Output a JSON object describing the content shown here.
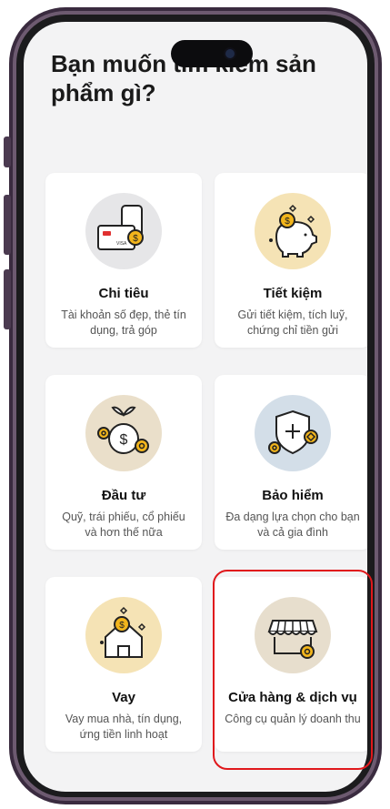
{
  "page": {
    "title": "Bạn muốn tìm kiếm sản phẩm gì?"
  },
  "cards": [
    {
      "title": "Chi tiêu",
      "desc": "Tài khoản số đẹp, thẻ tín dụng, trả góp",
      "icon": "card-payment-icon"
    },
    {
      "title": "Tiết kiệm",
      "desc": "Gửi tiết kiệm, tích luỹ, chứng chỉ tiền gửi",
      "icon": "piggy-bank-icon"
    },
    {
      "title": "Đầu tư",
      "desc": "Quỹ, trái phiếu, cổ phiếu và hơn thế nữa",
      "icon": "money-bag-icon"
    },
    {
      "title": "Bảo hiểm",
      "desc": "Đa dạng lựa chọn cho bạn và cả gia đình",
      "icon": "shield-plus-icon"
    },
    {
      "title": "Vay",
      "desc": "Vay mua nhà, tín dụng, ứng tiền linh hoạt",
      "icon": "house-coin-icon"
    },
    {
      "title": "Cửa hàng & dịch vụ",
      "desc": "Công cụ quản lý doanh thu",
      "icon": "storefront-icon"
    }
  ],
  "colors": {
    "highlight": "#e0181c",
    "coin": "#f2b51c",
    "frame": "#3a2b3f"
  }
}
